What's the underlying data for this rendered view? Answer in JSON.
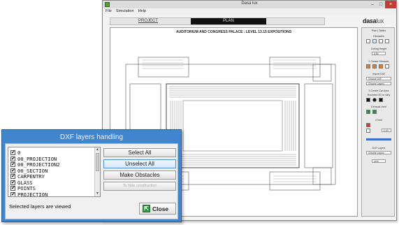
{
  "app": {
    "window_title": "Dasa lux",
    "menu": [
      "File",
      "Simulation",
      "Help"
    ],
    "tabs": {
      "project": "PROJECT",
      "plan": "PLAN"
    },
    "plan_title": "AUDITORIUM AND CONGRESS PALACE : LEVEL 13.15 EXPOSITIONS",
    "logo": {
      "bold": "dasa",
      "lite": "lux"
    }
  },
  "right_panel": {
    "tabs": [
      "Plan",
      "Tables"
    ],
    "sections": [
      "Obstacles",
      "Ceiling Height",
      "2 Create Obstacle",
      "Import DXF",
      "3 Create Car Area",
      "Rounded 2D or Vary",
      "Exhaust Vent",
      "4 Vent",
      "DXF Layers"
    ],
    "ceiling_value": "3.50",
    "buttons": [
      "Choose DXF",
      "Choose Layers",
      "Choose Layers"
    ],
    "vent_value": "0.00",
    "print": "print"
  },
  "dialog": {
    "title": "DXF layers handling",
    "layers": [
      {
        "name": "0",
        "checked": true
      },
      {
        "name": "00_PROJECTION",
        "checked": true
      },
      {
        "name": "00_PROJECTION2",
        "checked": true
      },
      {
        "name": "00_SECTION",
        "checked": true
      },
      {
        "name": "CARPENTRY",
        "checked": true
      },
      {
        "name": "GLASS",
        "checked": true
      },
      {
        "name": "POINTS",
        "checked": true
      },
      {
        "name": "PROJECTION",
        "checked": true
      }
    ],
    "buttons": {
      "select_all": "Select All",
      "unselect_all": "Unselect All",
      "make_obstacles": "Make Obstacles",
      "disabled_action": "To hide construction"
    },
    "status": "Selected layers are viewed",
    "close_label": "Close"
  }
}
